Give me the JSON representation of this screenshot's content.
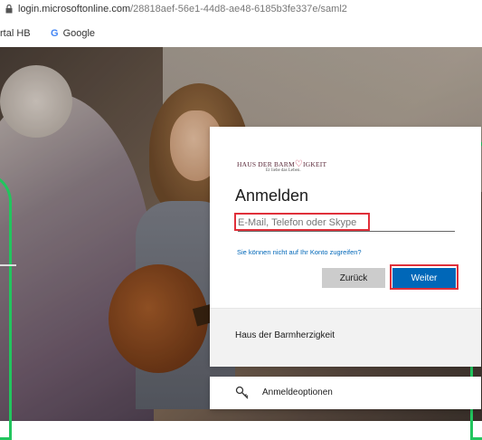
{
  "browser": {
    "url_host": "login.microsoftonline.com",
    "url_path": "/28818aef-56e1-44d8-ae48-6185b3fe337e/saml2",
    "bookmarks": [
      {
        "label": "rtal HB"
      },
      {
        "label": "Google",
        "icon": "google-icon"
      }
    ]
  },
  "login": {
    "org_logo": {
      "name_part1": "HAUS DER BARM",
      "heart": "♡",
      "name_part2": "IGKEIT",
      "tagline": "Er liebe das Leben."
    },
    "title": "Anmelden",
    "input_placeholder": "E-Mail, Telefon oder Skype",
    "cant_access_link": "Sie können nicht auf Ihr Konto zugreifen?",
    "back_button": "Zurück",
    "next_button": "Weiter",
    "footer_text": "Haus der Barmherzigkeit"
  },
  "sign_in_options": {
    "label": "Anmeldeoptionen",
    "icon": "key-icon"
  },
  "colors": {
    "accent_blue": "#0067b8",
    "highlight_red": "#e0303a",
    "bracket_green": "#22c55e"
  }
}
